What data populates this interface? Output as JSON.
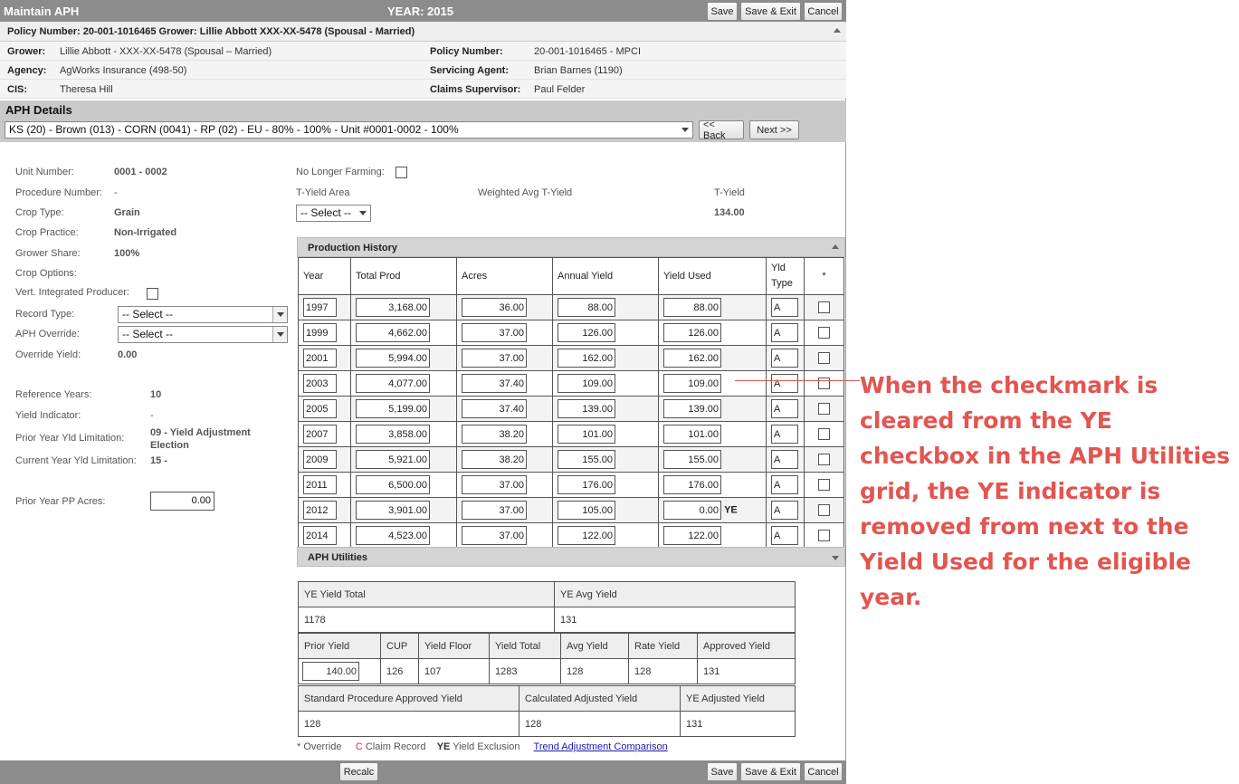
{
  "title": "Maintain APH",
  "year_label": "YEAR: 2015",
  "buttons": {
    "save": "Save",
    "save_exit": "Save & Exit",
    "cancel": "Cancel",
    "back": "<< Back",
    "next": "Next >>",
    "recalc": "Recalc"
  },
  "policy_bar": "Policy Number: 20-001-1016465 Grower: Lillie Abbott XXX-XX-5478 (Spousal - Married)",
  "info": {
    "grower_label": "Grower:",
    "grower": "Lillie Abbott - XXX-XX-5478 (Spousal – Married)",
    "policy_label": "Policy Number:",
    "policy": "20-001-1016465 - MPCI",
    "agency_label": "Agency:",
    "agency": "AgWorks Insurance (498-50)",
    "agent_label": "Servicing Agent:",
    "agent": "Brian Barnes (1190)",
    "cis_label": "CIS:",
    "cis": "Theresa Hill",
    "claims_label": "Claims Supervisor:",
    "claims": "Paul Felder"
  },
  "aph": {
    "heading": "APH Details",
    "unit_select": "KS (20) - Brown (013) - CORN (0041) - RP (02) - EU - 80% - 100% - Unit #0001-0002 - 100%"
  },
  "details": {
    "unit_number_label": "Unit Number:",
    "unit_number": "0001 - 0002",
    "procedure_label": "Procedure Number:",
    "procedure": "-",
    "crop_type_label": "Crop Type:",
    "crop_type": "Grain",
    "crop_practice_label": "Crop Practice:",
    "crop_practice": "Non-Irrigated",
    "grower_share_label": "Grower Share:",
    "grower_share": "100%",
    "crop_options_label": "Crop Options:",
    "vert_label": "Vert. Integrated Producer:",
    "record_type_label": "Record Type:",
    "record_type": "-- Select --",
    "aph_override_label": "APH Override:",
    "aph_override": "-- Select --",
    "override_yield_label": "Override Yield:",
    "override_yield": "0.00",
    "ref_years_label": "Reference Years:",
    "ref_years": "10",
    "yield_ind_label": "Yield Indicator:",
    "yield_ind": "-",
    "prior_lim_label": "Prior Year Yld Limitation:",
    "prior_lim": "09 - Yield Adjustment Election",
    "current_lim_label": "Current Year Yld Limitation:",
    "current_lim": "15 -",
    "pp_acres_label": "Prior Year PP Acres:",
    "pp_acres": "0.00",
    "no_longer_label": "No Longer Farming:",
    "tyield_area_label": "T-Yield Area",
    "tyield_area": "-- Select --",
    "weighted_label": "Weighted Avg T-Yield",
    "tyield_label": "T-Yield",
    "tyield": "134.00"
  },
  "production": {
    "heading": "Production History",
    "columns": [
      "Year",
      "Total Prod",
      "Acres",
      "Annual Yield",
      "Yield Used",
      "Yld Type",
      "*"
    ],
    "rows": [
      {
        "year": "1997",
        "prod": "3,168.00",
        "acres": "36.00",
        "annual": "88.00",
        "used": "88.00",
        "ye": "",
        "type": "A"
      },
      {
        "year": "1999",
        "prod": "4,662.00",
        "acres": "37.00",
        "annual": "126.00",
        "used": "126.00",
        "ye": "",
        "type": "A"
      },
      {
        "year": "2001",
        "prod": "5,994.00",
        "acres": "37.00",
        "annual": "162.00",
        "used": "162.00",
        "ye": "",
        "type": "A"
      },
      {
        "year": "2003",
        "prod": "4,077.00",
        "acres": "37.40",
        "annual": "109.00",
        "used": "109.00",
        "ye": "",
        "type": "A"
      },
      {
        "year": "2005",
        "prod": "5,199.00",
        "acres": "37.40",
        "annual": "139.00",
        "used": "139.00",
        "ye": "",
        "type": "A"
      },
      {
        "year": "2007",
        "prod": "3,858.00",
        "acres": "38.20",
        "annual": "101.00",
        "used": "101.00",
        "ye": "",
        "type": "A"
      },
      {
        "year": "2009",
        "prod": "5,921.00",
        "acres": "38.20",
        "annual": "155.00",
        "used": "155.00",
        "ye": "",
        "type": "A"
      },
      {
        "year": "2011",
        "prod": "6,500.00",
        "acres": "37.00",
        "annual": "176.00",
        "used": "176.00",
        "ye": "",
        "type": "A"
      },
      {
        "year": "2012",
        "prod": "3,901.00",
        "acres": "37.00",
        "annual": "105.00",
        "used": "0.00",
        "ye": "YE",
        "type": "A"
      },
      {
        "year": "2014",
        "prod": "4,523.00",
        "acres": "37.00",
        "annual": "122.00",
        "used": "122.00",
        "ye": "",
        "type": "A"
      }
    ]
  },
  "utilities": {
    "heading": "APH Utilities"
  },
  "summary": {
    "ye_total_label": "YE Yield Total",
    "ye_total": "1178",
    "ye_avg_label": "YE Avg Yield",
    "ye_avg": "131",
    "prior_yield_label": "Prior Yield",
    "prior_yield": "140.00",
    "cup_label": "CUP",
    "cup": "126",
    "yield_floor_label": "Yield Floor",
    "yield_floor": "107",
    "yield_total_label": "Yield Total",
    "yield_total": "1283",
    "avg_yield_label": "Avg Yield",
    "avg_yield": "128",
    "rate_yield_label": "Rate Yield",
    "rate_yield": "128",
    "approved_label": "Approved Yield",
    "approved": "131",
    "std_label": "Standard Procedure Approved Yield",
    "std": "128",
    "calc_label": "Calculated Adjusted Yield",
    "calc": "128",
    "ye_adj_label": "YE Adjusted Yield",
    "ye_adj": "131"
  },
  "legend": {
    "override": "* Override",
    "c": "C",
    "claim": "Claim Record",
    "ye": "YE",
    "ye_text": "Yield Exclusion",
    "link": "Trend Adjustment Comparison"
  },
  "annotation": "When the checkmark is cleared from the YE checkbox in the APH Utilities grid, the YE indicator is removed from next to the Yield Used for the eligible year.",
  "colors": {
    "titlebar": "#8c8c8c",
    "annotation": "#e25550",
    "link": "#1a1ab0"
  }
}
